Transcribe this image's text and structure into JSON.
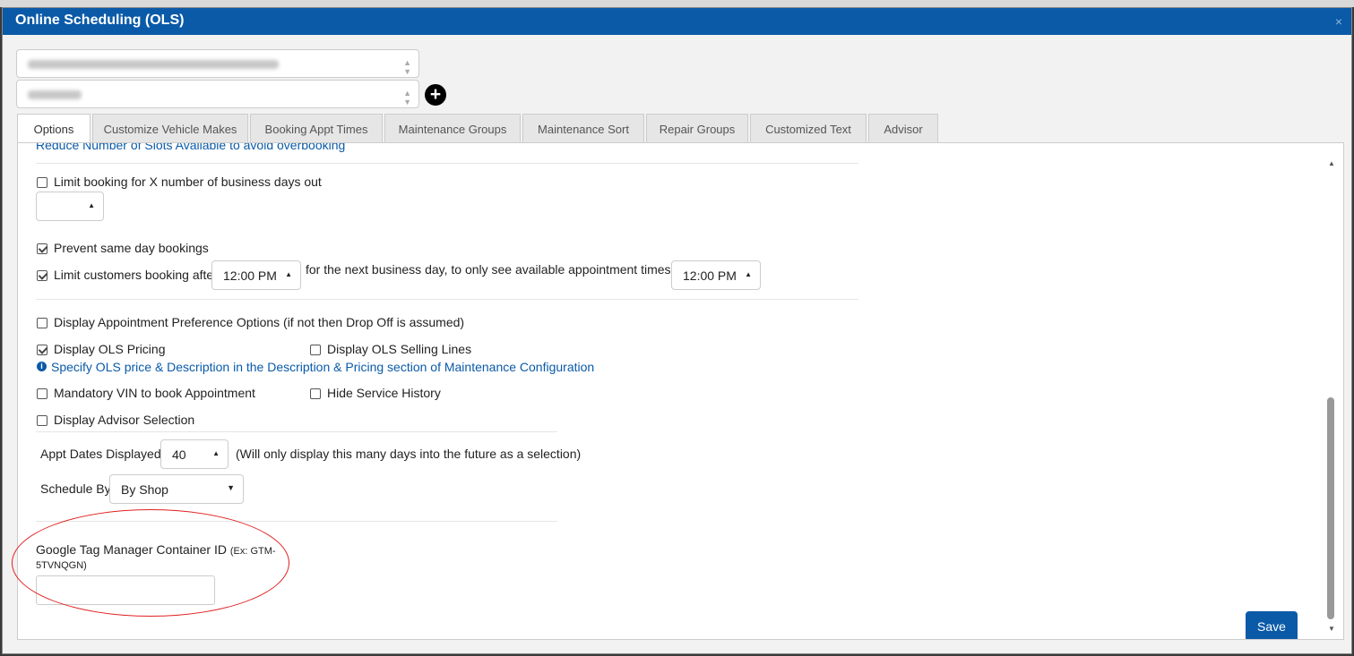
{
  "dialog": {
    "title": "Online Scheduling (OLS)",
    "close": "×"
  },
  "selectors": {
    "plus": "+"
  },
  "tabs": [
    "Options",
    "Customize Vehicle Makes",
    "Booking Appt Times",
    "Maintenance Groups",
    "Maintenance Sort",
    "Repair Groups",
    "Customized Text",
    "Advisor"
  ],
  "options": {
    "cutoff_link": "Reduce Number of Slots Available to avoid overbooking",
    "limit_days_label": "Limit booking for X number of business days out",
    "prevent_same_day": "Prevent same day bookings",
    "limit_after_label": "Limit customers booking after",
    "limit_after_time": "12:00 PM",
    "next_day_label": "for the next business day, to only see available appointment times after",
    "next_day_time": "12:00 PM",
    "appt_pref": "Display Appointment Preference Options (if not then Drop Off is assumed)",
    "ols_pricing": "Display OLS Pricing",
    "ols_selling": "Display OLS Selling Lines",
    "pricing_info": "Specify OLS price & Description in the Description & Pricing section of Maintenance Configuration",
    "mandatory_vin": "Mandatory VIN to book Appointment",
    "hide_history": "Hide Service History",
    "advisor_sel": "Display Advisor Selection",
    "appt_dates_label": "Appt Dates Displayed",
    "appt_dates_value": "40",
    "appt_dates_note": "(Will only display this many days into the future as a selection)",
    "schedule_by_label": "Schedule By",
    "schedule_by_value": "By Shop",
    "gtm_label": "Google Tag Manager Container ID",
    "gtm_hint_1": "(Ex: GTM-",
    "gtm_hint_2": "5TVNQGN)",
    "gtm_value": "",
    "save": "Save"
  }
}
